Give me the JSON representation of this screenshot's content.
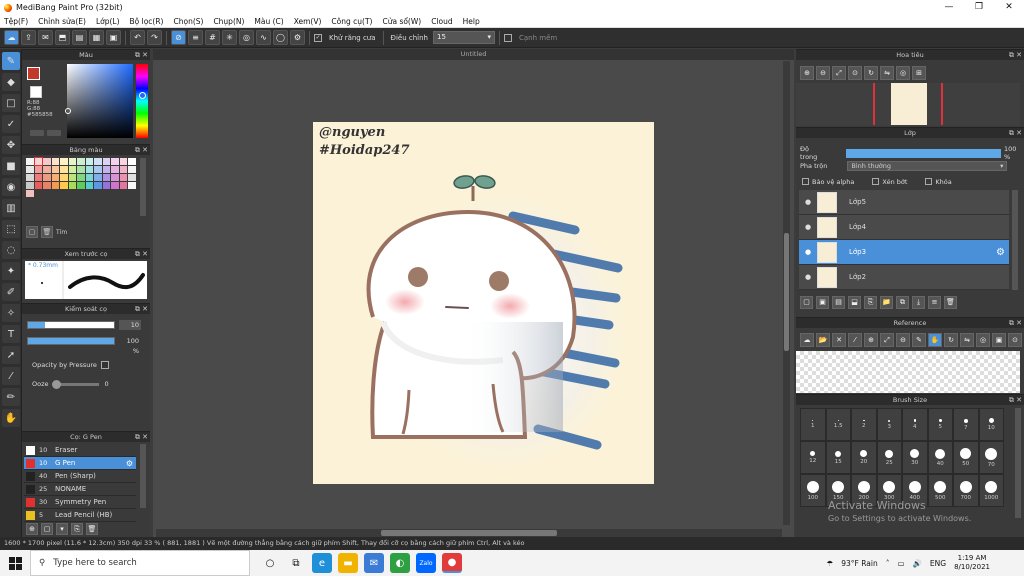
{
  "window": {
    "title": "MediBang Paint Pro (32bit)",
    "min": "—",
    "max": "❐",
    "close": "✕"
  },
  "menu": [
    "Tệp(F)",
    "Chỉnh sửa(E)",
    "Lớp(L)",
    "Bộ lọc(R)",
    "Chọn(S)",
    "Chụp(N)",
    "Màu (C)",
    "Xem(V)",
    "Công cụ(T)",
    "Cửa sổ(W)",
    "Cloud",
    "Help"
  ],
  "toolbar": {
    "antialias_label": "Khử răng cưa",
    "adjust_label": "Điều chỉnh",
    "adjust_value": "15",
    "snap_label": "Cạnh mềm"
  },
  "panels": {
    "color": {
      "title": "Màu",
      "rgb_text": "R:88\nG:88\n#585858"
    },
    "palette": {
      "title": "Bảng màu",
      "name": "Tím"
    },
    "preview": {
      "title": "Xem trước cọ",
      "size": "* 0.73mm"
    },
    "brush_control": {
      "title": "Kiểm soát cọ",
      "size_value": "10",
      "opacity_value": "100 %",
      "opacity_pressure_label": "Opacity by Pressure",
      "ooze_label": "Ooze",
      "ooze_value": "0"
    },
    "brush": {
      "title": "Cọ: G Pen",
      "items": [
        {
          "size": "10",
          "name": "Eraser",
          "color": "#ffffff"
        },
        {
          "size": "10",
          "name": "G Pen",
          "color": "#e03030",
          "selected": true
        },
        {
          "size": "40",
          "name": "Pen (Sharp)",
          "color": "#222222"
        },
        {
          "size": "25",
          "name": "NONAME",
          "color": "#222222"
        },
        {
          "size": "30",
          "name": "Symmetry Pen",
          "color": "#e03030"
        },
        {
          "size": "5",
          "name": "Lead Pencil (HB)",
          "color": "#e8c020"
        }
      ]
    },
    "navigator": {
      "title": "Hoa tiêu"
    },
    "layer": {
      "title": "Lớp",
      "opacity_label": "Độ trong",
      "opacity_value": "100 %",
      "blend_label": "Pha trộn",
      "blend_value": "Bình thường",
      "protect_alpha": "Bảo vệ alpha",
      "clipping": "Xén bớt",
      "lock": "Khóa",
      "layers": [
        {
          "name": "Lớp5",
          "selected": false
        },
        {
          "name": "Lớp4",
          "selected": false
        },
        {
          "name": "Lớp3",
          "selected": true
        },
        {
          "name": "Lớp2",
          "selected": false
        }
      ]
    },
    "reference": {
      "title": "Reference"
    },
    "brush_size": {
      "title": "Brush Size",
      "sizes": [
        "1",
        "1.5",
        "2",
        "3",
        "4",
        "5",
        "7",
        "10",
        "12",
        "15",
        "20",
        "25",
        "30",
        "40",
        "50",
        "70",
        "100",
        "150",
        "200",
        "300",
        "400",
        "500",
        "700",
        "1000"
      ],
      "watermark_title": "Activate Windows",
      "watermark_sub": "Go to Settings to activate Windows."
    }
  },
  "canvas": {
    "tab_title": "Untitled",
    "sign_line1": "@nguyen",
    "sign_line2": "#Hoidap247"
  },
  "status": {
    "text": "1600 * 1700 pixel   (11.6 * 12.3cm)   350 dpi   33 %   ( 881, 1881 )   Vẽ một đường thẳng bằng cách giữ phím Shift, Thay đổi cỡ cọ bằng cách giữ phím Ctrl, Alt và kéo"
  },
  "taskbar": {
    "search_placeholder": "Type here to search",
    "weather": "93°F  Rain",
    "lang": "ENG",
    "time": "1:19 AM",
    "date": "8/10/2021"
  },
  "colors": {
    "accent": "#4a90d9",
    "canvas_bg": "#fbf2d8",
    "stroke_blue": "#3f6fa8"
  }
}
